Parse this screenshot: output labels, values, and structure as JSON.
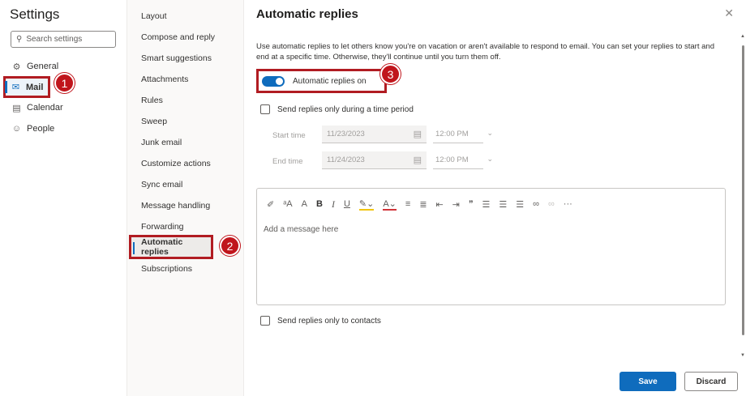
{
  "settings": {
    "title": "Settings",
    "search_placeholder": "Search settings",
    "nav": [
      {
        "label": "General",
        "icon": "gear-icon"
      },
      {
        "label": "Mail",
        "icon": "mail-icon"
      },
      {
        "label": "Calendar",
        "icon": "calendar-icon"
      },
      {
        "label": "People",
        "icon": "people-icon"
      }
    ]
  },
  "mail_sub": {
    "items": [
      "Layout",
      "Compose and reply",
      "Smart suggestions",
      "Attachments",
      "Rules",
      "Sweep",
      "Junk email",
      "Customize actions",
      "Sync email",
      "Message handling",
      "Forwarding",
      "Automatic replies",
      "Subscriptions"
    ],
    "active": "Automatic replies"
  },
  "annotations": {
    "one": "1",
    "two": "2",
    "three": "3"
  },
  "panel": {
    "title": "Automatic replies",
    "description": "Use automatic replies to let others know you're on vacation or aren't available to respond to email. You can set your replies to start and end at a specific time. Otherwise, they'll continue until you turn them off.",
    "toggle_label": "Automatic replies on",
    "toggle_on": true,
    "time_period_label": "Send replies only during a time period",
    "start_label": "Start time",
    "start_date": "11/23/2023",
    "start_time": "12:00 PM",
    "end_label": "End time",
    "end_date": "11/24/2023",
    "end_time": "12:00 PM",
    "message_placeholder": "Add a message here",
    "contacts_label": "Send replies only to contacts",
    "save_label": "Save",
    "discard_label": "Discard"
  },
  "toolbar": {
    "font_size_increase": "A",
    "superscript": "A",
    "bold": "B",
    "italic": "I",
    "underline": "U",
    "font_color": "A",
    "quote": "”",
    "more": "···"
  },
  "colors": {
    "accent": "#0f6cbd",
    "annotation": "#c0151c"
  }
}
